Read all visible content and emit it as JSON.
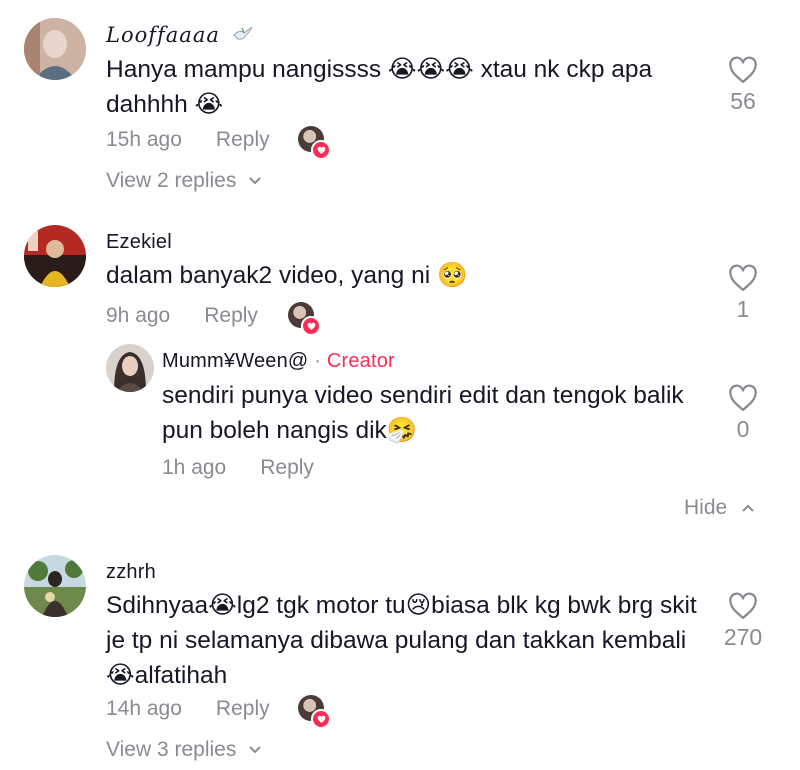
{
  "comments": [
    {
      "username": "Looffaaaa",
      "text": "Hanya mampu nangissss 😭😭😭 xtau nk ckp apa dahhhh 😭",
      "time": "15h ago",
      "reply": "Reply",
      "likes": "56",
      "view_replies": "View 2 replies"
    },
    {
      "username": "Ezekiel",
      "text": "dalam banyak2 video, yang ni 🥺",
      "time": "9h ago",
      "reply": "Reply",
      "likes": "1"
    },
    {
      "username": "zzhrh",
      "text": "Sdihnyaa😭lg2 tgk motor tu😢biasa blk kg bwk brg skit je tp ni selamanya dibawa pulang dan takkan kembali😭alfatihah",
      "time": "14h ago",
      "reply": "Reply",
      "likes": "270",
      "view_replies": "View 3 replies"
    }
  ],
  "reply": {
    "username": "Mumm¥Ween@",
    "dot": "·",
    "badge": "Creator",
    "text": "sendiri punya video sendiri edit dan tengok balik pun boleh nangis dik🤧",
    "time": "1h ago",
    "reply": "Reply",
    "likes": "0"
  },
  "hide_label": "Hide",
  "icons": {
    "heart": "heart-outline-icon",
    "chevron_down": "chevron-down-icon",
    "chevron_up": "chevron-up-icon",
    "dove": "dove-icon"
  },
  "colors": {
    "accent": "#fe2c55",
    "muted": "#8a8b91",
    "text": "#161823"
  }
}
